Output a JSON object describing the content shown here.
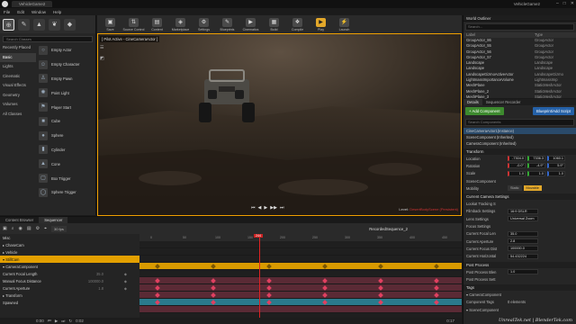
{
  "titlebar": {
    "tab": "VehicleGame2",
    "project": "VehicleGame2"
  },
  "menu": [
    "File",
    "Edit",
    "Window",
    "Help"
  ],
  "modes": {
    "search_placeholder": "Search Classes",
    "categories": [
      "Recently Placed",
      "Basic",
      "Lights",
      "Cinematic",
      "Visual Effects",
      "Geometry",
      "Volumes",
      "All Classes"
    ],
    "selected_category": "Basic",
    "items": [
      "Empty Actor",
      "Empty Character",
      "Empty Pawn",
      "Point Light",
      "Player Start",
      "Cube",
      "Sphere",
      "Cylinder",
      "Cone",
      "Box Trigger",
      "Sphere Trigger"
    ]
  },
  "toolbar": [
    "Save",
    "Source Control",
    "Content",
    "Marketplace",
    "Settings",
    "Blueprints",
    "Cinematics",
    "Build",
    "Compile",
    "Play",
    "Launch"
  ],
  "viewport": {
    "label": "[ Pilot Active - CineCameraActor ]",
    "level": "Level:",
    "level_name": "DesertBodyScene (Persistent)"
  },
  "outliner": {
    "title": "World Outliner",
    "search_placeholder": "Search...",
    "col_label": "Label",
    "col_type": "Type",
    "rows": [
      {
        "label": "GroupActor_86",
        "type": "GroupActor"
      },
      {
        "label": "GroupActor_55",
        "type": "GroupActor"
      },
      {
        "label": "GroupActor_56",
        "type": "GroupActor"
      },
      {
        "label": "GroupActor_57",
        "type": "GroupActor"
      },
      {
        "label": "Landscape",
        "type": "Landscape"
      },
      {
        "label": "Landscape",
        "type": "Landscape"
      },
      {
        "label": "LandscapeGizmoActiveActor",
        "type": "LandscapeGizmo"
      },
      {
        "label": "LightmassImportanceVolume",
        "type": "LightmassImp"
      },
      {
        "label": "MeshPlane",
        "type": "StaticMeshActor"
      },
      {
        "label": "MeshPlane_2",
        "type": "StaticMeshActor"
      },
      {
        "label": "MeshPlane_3",
        "type": "StaticMeshActor"
      }
    ],
    "count": "1,141 actors",
    "view_options": "View Options"
  },
  "details": {
    "tabs": [
      "Details",
      "Sequencer Recorder"
    ],
    "add_component": "+ Add Component",
    "blueprint": "Blueprint/Add Script",
    "search_placeholder": "Search Components",
    "components": [
      "CineCameraActor1(Instance)",
      "SceneComponent (Inherited)",
      "CameraComponent (Inherited)"
    ],
    "transform": "Transform",
    "location": {
      "label": "Location",
      "x": "-7304.0",
      "y": "7336.3",
      "z": "1060.1"
    },
    "rotation": {
      "label": "Rotation",
      "x": "-0.0°",
      "y": "-4.9°",
      "z": "5.9°"
    },
    "scale": {
      "label": "Scale",
      "x": "1.0",
      "y": "1.0",
      "z": "1.0"
    },
    "scene_component": "SceneComponent",
    "mobility": "Mobility",
    "mobility_options": [
      "Static",
      "Movable"
    ],
    "camera_settings": "Current Camera Settings",
    "props": [
      {
        "label": "Lookat Tracking S",
        "value": ""
      },
      {
        "label": "Filmback Settings",
        "value": "16:9 DSLR"
      },
      {
        "label": "Lens Settings",
        "value": "Universal Zoom"
      },
      {
        "label": "Focus Settings",
        "value": ""
      },
      {
        "label": "Current Focal Len",
        "value": "35.0"
      },
      {
        "label": "Current Aperture",
        "value": "2.8"
      },
      {
        "label": "Current Focus Dist",
        "value": "100000.0"
      },
      {
        "label": "Current Horizontal",
        "value": "54.432224"
      }
    ],
    "post_process": "Post Process",
    "pp_props": [
      {
        "label": "Post Process Blen",
        "value": "1.0"
      },
      {
        "label": "Post Process Sett",
        "value": ""
      }
    ],
    "tags": "Tags",
    "tag_rows": [
      "▾ CameraComponent",
      "Component Tags",
      "▾ SceneComponent"
    ],
    "tag_count": "0 elements"
  },
  "bottom": {
    "tabs": [
      "Content Browser",
      "Sequencer"
    ],
    "fps": "30 fps",
    "seq_name": "RecordedSequence_2",
    "add": "+ Track",
    "frame": "244",
    "tracks": [
      {
        "label": "Misc",
        "value": "",
        "hl": false
      },
      {
        "label": "▸ ChaseCam",
        "value": "",
        "hl": false
      },
      {
        "label": "▸ Vehicle",
        "value": "",
        "hl": false
      },
      {
        "label": "▾ StillCam",
        "value": "",
        "hl": true
      },
      {
        "label": "▾ CameraComponent",
        "value": "",
        "hl": false
      },
      {
        "label": "Current Focal Length",
        "value": "35.0",
        "hl": false
      },
      {
        "label": "Manual Focus Distance",
        "value": "100000.0",
        "hl": false
      },
      {
        "label": "Current Aperture",
        "value": "1.8",
        "hl": false
      },
      {
        "label": "▸ Transform",
        "value": "",
        "hl": false
      },
      {
        "label": "Spawned",
        "value": "",
        "hl": false
      }
    ],
    "ticks": [
      "0",
      "50",
      "100",
      "150",
      "200",
      "250",
      "300",
      "350",
      "400",
      "450"
    ],
    "time_start": "0:00",
    "time_mid": "0:02",
    "time_end": "0:17"
  },
  "watermark": "UnrealTek.net | BlenderTek.com"
}
